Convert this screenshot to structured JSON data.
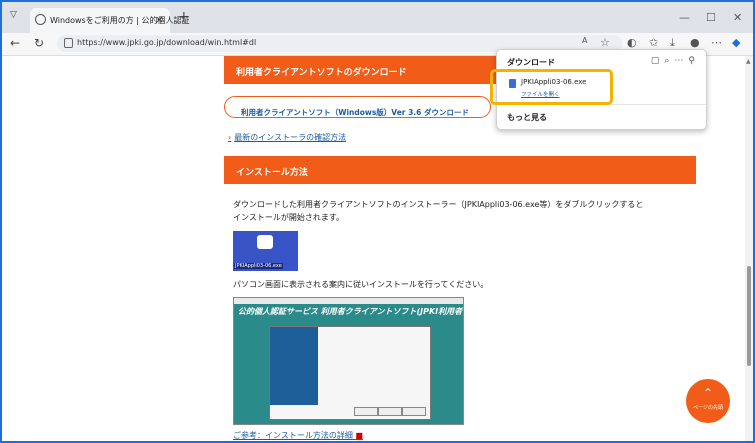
{
  "browser": {
    "tab_title": "Windowsをご利用の方 | 公的個人認証",
    "tab_close": "×",
    "new_tab": "+",
    "url": "https://www.jpki.go.jp/download/win.html#dl",
    "window_controls": [
      "—",
      "☐",
      "✕"
    ]
  },
  "download_panel": {
    "title": "ダウンロード",
    "file_name": "JPKIAppli03-06.exe",
    "open_file": "ファイルを開く",
    "more": "もっと見る"
  },
  "page": {
    "section1_title": "利用者クライアントソフトのダウンロード",
    "download_link": "利用者クライアントソフト（Windows版）Ver 3.6 ダウンロード",
    "installer_check_link": "最新のインストーラの確認方法",
    "section2_title": "インストール方法",
    "instruction1_line1": "ダウンロードした利用者クライアントソフトのインストーラー（JPKIAppli03-06.exe等）をダブルクリックすると",
    "instruction1_line2": "インストールが開始されます。",
    "app_icon_label": "JPKIAppli03-06.exe",
    "instruction2": "パソコン画面に表示される案内に従いインストールを行ってください。",
    "installer_banner": "公的個人認証サービス 利用者クライアントソフト(JPKI利用者ソフト)",
    "reference_link": "ご参考：インストール方法の詳細",
    "page_top": "ページの先頭"
  },
  "colors": {
    "accent": "#f25c19",
    "link": "#1a5ba6",
    "highlight": "#f2b400"
  }
}
